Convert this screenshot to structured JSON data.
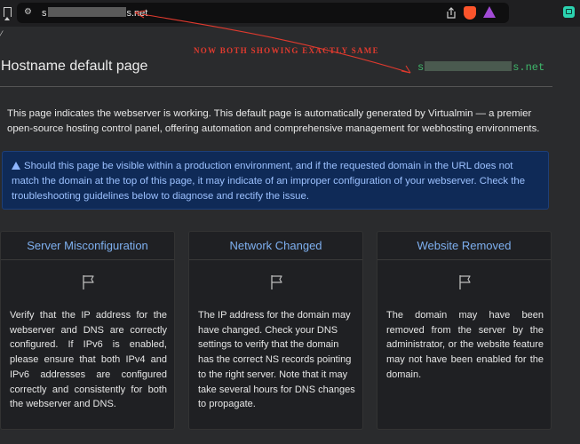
{
  "browser": {
    "url_prefix": "s",
    "url_suffix": "s.net",
    "corner_mark": "⁄"
  },
  "annotation": {
    "text": "NOW BOTH SHOWING EXACTLY SAME",
    "color": "#e03a2e"
  },
  "page": {
    "title": "Hostname default page",
    "hostname_prefix": "s",
    "hostname_suffix": "s.net",
    "intro": "This page indicates the webserver is working. This default page is automatically generated by Virtualmin — a premier open-source hosting control panel, offering automation and comprehensive management for webhosting environments.",
    "alert": "Should this page be visible within a production environment, and if the requested domain in the URL does not match the domain at the top of this page, it may indicate of an improper configuration of your webserver. Check the troubleshooting guidelines below to diagnose and rectify the issue."
  },
  "cards": [
    {
      "title": "Server Misconfiguration",
      "icon": "flag-icon",
      "body": "Verify that the IP address for the webserver and DNS are correctly configured. If IPv6 is enabled, please ensure that both IPv4 and IPv6 addresses are configured correctly and consistently for both the webserver and DNS."
    },
    {
      "title": "Network Changed",
      "icon": "flag-icon",
      "body": "The IP address for the domain may have changed. Check your DNS settings to verify that the domain has the correct NS records pointing to the right server. Note that it may take several hours for DNS changes to propagate."
    },
    {
      "title": "Website Removed",
      "icon": "flag-icon",
      "body": "The domain may have been removed from the server by the administrator, or the website feature may not have been enabled for the domain."
    }
  ],
  "colors": {
    "link_blue": "#7eb0f0",
    "alert_bg": "#0f2a57",
    "hostname_green": "#3fb86b"
  }
}
